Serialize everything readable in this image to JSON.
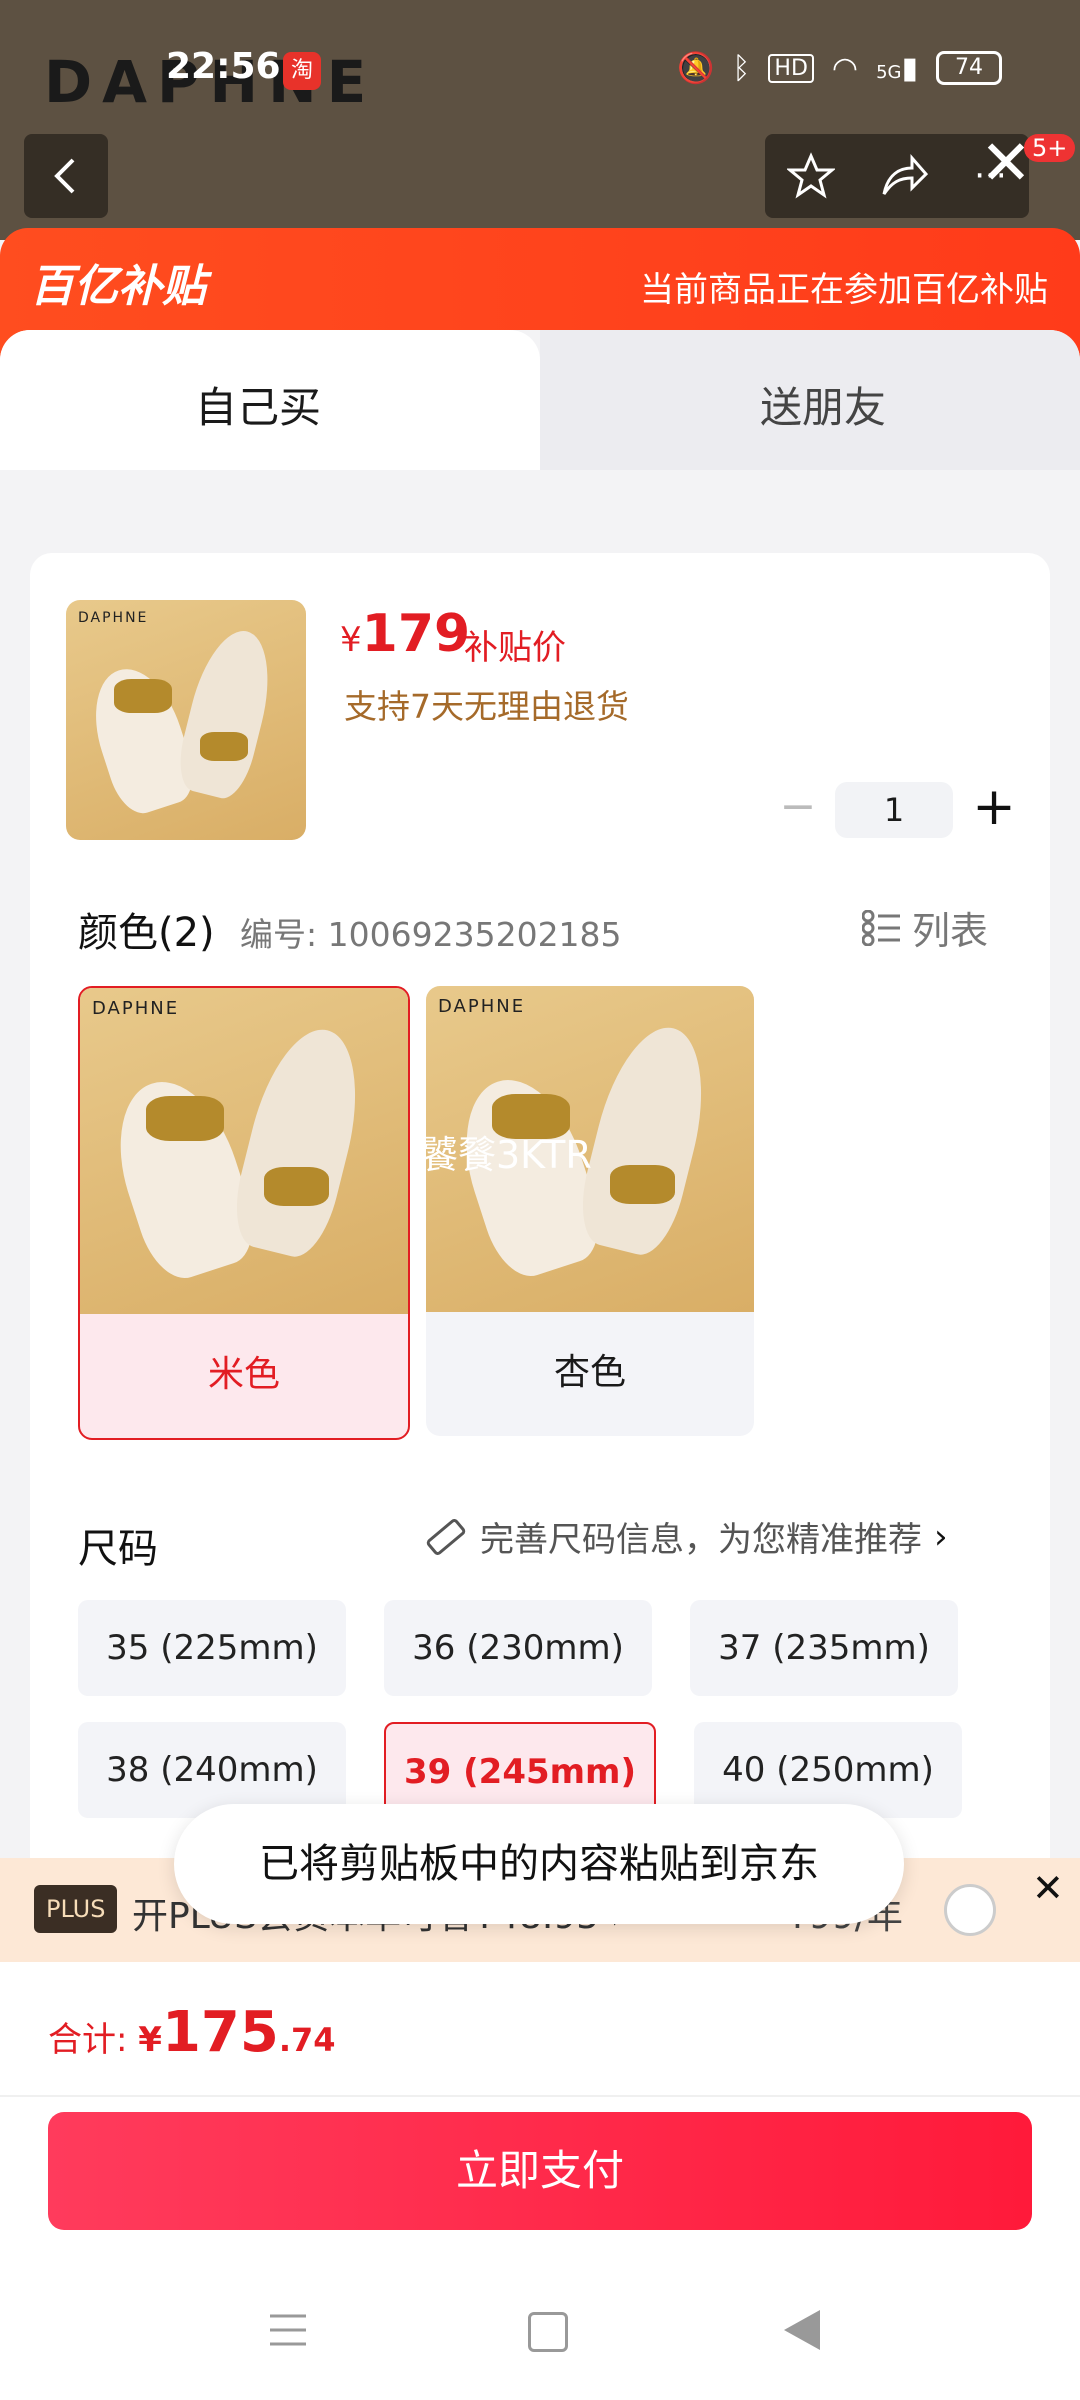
{
  "status_bar": {
    "time": "22:56",
    "app_icon": "淘",
    "battery": "74",
    "network": "5G"
  },
  "brand_logo": "DAPHNE",
  "top_actions": {
    "badge": "5+"
  },
  "banner": {
    "logo_text": "百亿补贴",
    "tip": "当前商品正在参加百亿补贴"
  },
  "tabs": [
    {
      "label": "自己买"
    },
    {
      "label": "送朋友"
    }
  ],
  "product": {
    "thumb_brand": "DAPHNE",
    "price_currency": "¥",
    "price": "179",
    "price_tag": "补贴价",
    "return_note": "支持7天无理由退货",
    "quantity": "1",
    "qty_minus": "−",
    "qty_plus": "+"
  },
  "color_section": {
    "title": "颜色(2)",
    "sku": "编号: 10069235202185",
    "list_label": "列表",
    "options": [
      {
        "label": "米色",
        "brand": "DAPHNE",
        "selected": true
      },
      {
        "label": "杏色",
        "brand": "DAPHNE",
        "selected": false
      }
    ],
    "watermark": "饕餮3KTR"
  },
  "size_section": {
    "title": "尺码",
    "tip": "完善尺码信息，为您精准推荐",
    "sizes": [
      {
        "label": "35 (225mm)",
        "selected": false
      },
      {
        "label": "36 (230mm)",
        "selected": false
      },
      {
        "label": "37 (235mm)",
        "selected": false
      },
      {
        "label": "38 (240mm)",
        "selected": false
      },
      {
        "label": "39 (245mm)",
        "selected": true
      },
      {
        "label": "40 (250mm)",
        "selected": false
      }
    ]
  },
  "plus_bar": {
    "tag": "PLUS",
    "text": "开PLUS会员本单可省¥48.95 ›",
    "price": "¥99/年",
    "close": "✕"
  },
  "toast": "已将剪贴板中的内容粘贴到京东",
  "footer": {
    "total_label": "合计: ",
    "total_currency": "¥",
    "total_int": "175",
    "total_dec": ".74",
    "pay_label": "立即支付"
  },
  "colors": {
    "accent": "#e21d23",
    "banner": "#ff4d1f",
    "pay_button": "#ff2a48"
  }
}
